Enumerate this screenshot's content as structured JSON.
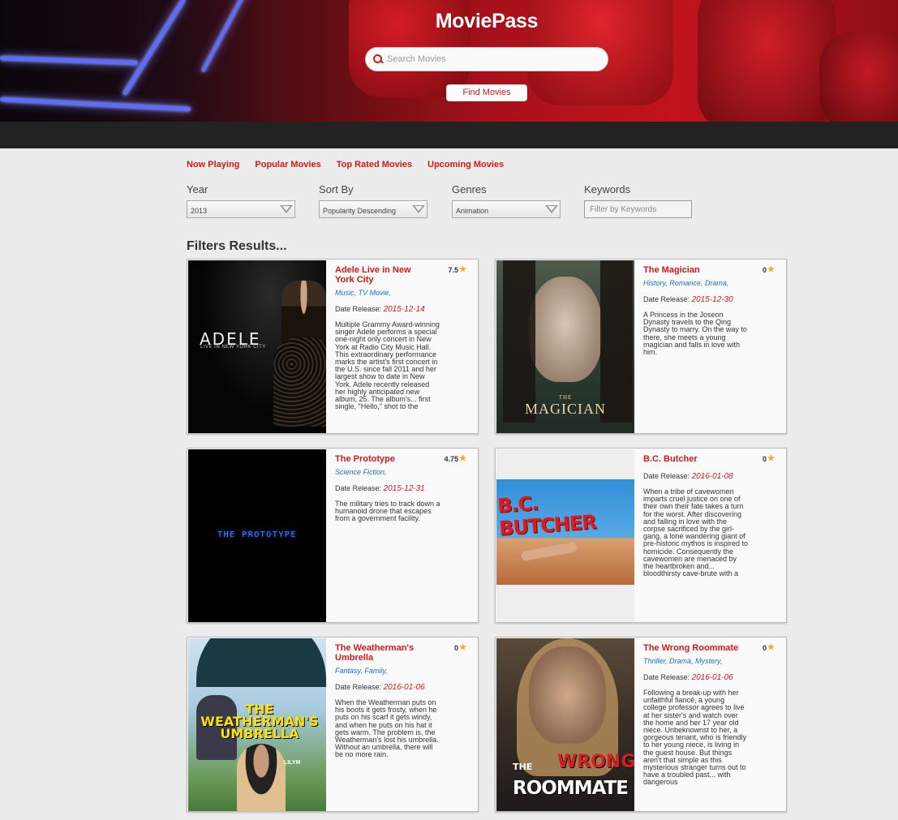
{
  "app": {
    "title": "MoviePass"
  },
  "search": {
    "placeholder": "Search Movies",
    "button_label": "Find Movies"
  },
  "nav": [
    "Now Playing",
    "Popular Movies",
    "Top Rated Movies",
    "Upcoming Movies"
  ],
  "filters": {
    "year": {
      "label": "Year",
      "value": "2013"
    },
    "sort_by": {
      "label": "Sort By",
      "value": "Popularity Descending"
    },
    "genres": {
      "label": "Genres",
      "value": "Animation"
    },
    "keywords": {
      "label": "Keywords",
      "placeholder": "Filter by Keywords"
    }
  },
  "results_title": "Filters Results...",
  "release_label": "Date Release:",
  "accent_color": "#d01a1a",
  "star_color": "#f5a623",
  "movies": [
    {
      "title": "Adele Live in New York City",
      "rating": "7.5",
      "genres": "Music, TV Movie,",
      "release": "2015-12-14",
      "overview": "Multiple Grammy Award-winning singer Adele performs a special one-night only concert in New York at Radio City Music Hall. This extraordinary performance marks the artist's first concert in the U.S. since fall 2011 and her largest show to date in New York. Adele recently released her highly anticipated new album, 25. The album's... first single, \"Hello,\" shot to the",
      "poster_text": {
        "line1": "ADELE",
        "line2": "LIVE IN NEW YORK CITY"
      }
    },
    {
      "title": "The Magician",
      "rating": "0",
      "genres": "History, Romance, Drama,",
      "release": "2015-12-30",
      "overview": "A Princess in the Joseon Dynasty travels to the Qing Dynasty to marry. On the way to there, she meets a young magician and falls in love with him.",
      "poster_text": {
        "line1": "THE",
        "line2": "MAGICIAN"
      }
    },
    {
      "title": "The Prototype",
      "rating": "4.75",
      "genres": "Science Fiction,",
      "release": "2015-12-31",
      "overview": "The military tries to track down a humanoid drone that escapes from a government facility.",
      "poster_text": {
        "line1": "THE PROTOTYPE"
      }
    },
    {
      "title": "B.C. Butcher",
      "rating": "0",
      "genres": "",
      "release": "2016-01-08",
      "overview": "When a tribe of cavewomen imparts cruel justice on one of their own their fate takes a turn for the worst. After discovering and falling in love with the corpse sacrificed by the girl-gang, a lone wandering giant of pre-historic mythos is inspired to homicide. Consequently the cavewomen are menaced by the heartbroken and... bloodthirsty cave-brute with a",
      "poster_text": {
        "line1": "B.C. BUTCHER"
      }
    },
    {
      "title": "The Weatherman's Umbrella",
      "rating": "0",
      "genres": "Fantasy, Family,",
      "release": "2016-01-06",
      "overview": "When the Weatherman puts on his boots it gets frosty, when he puts on his scarf it gets windy, and when he puts on his hat it gets warm. The problem is, the Weatherman's lost his umbrella. Without an umbrella, there will be no more rain.",
      "poster_text": {
        "line1": "THE",
        "line2": "WEATHERMAN'S UMBRELLA",
        "line3": "LILYM"
      }
    },
    {
      "title": "The Wrong Roommate",
      "rating": "0",
      "genres": "Thriller, Drama, Mystery,",
      "release": "2016-01-06",
      "overview": "Following a break-up with her unfaithful fiancé, a young college professor agrees to live at her sister's and watch over the home and her 17 year old niece. Unbeknownst to her, a gorgeous tenant, who is friendly to her young niece, is living in the guest house. But things aren't that simple as this mysterious stranger turns out to have a troubled past... with dangerous",
      "poster_text": {
        "line1": "THE",
        "line2": "WRONG",
        "line3": "ROOMMATE"
      }
    }
  ]
}
